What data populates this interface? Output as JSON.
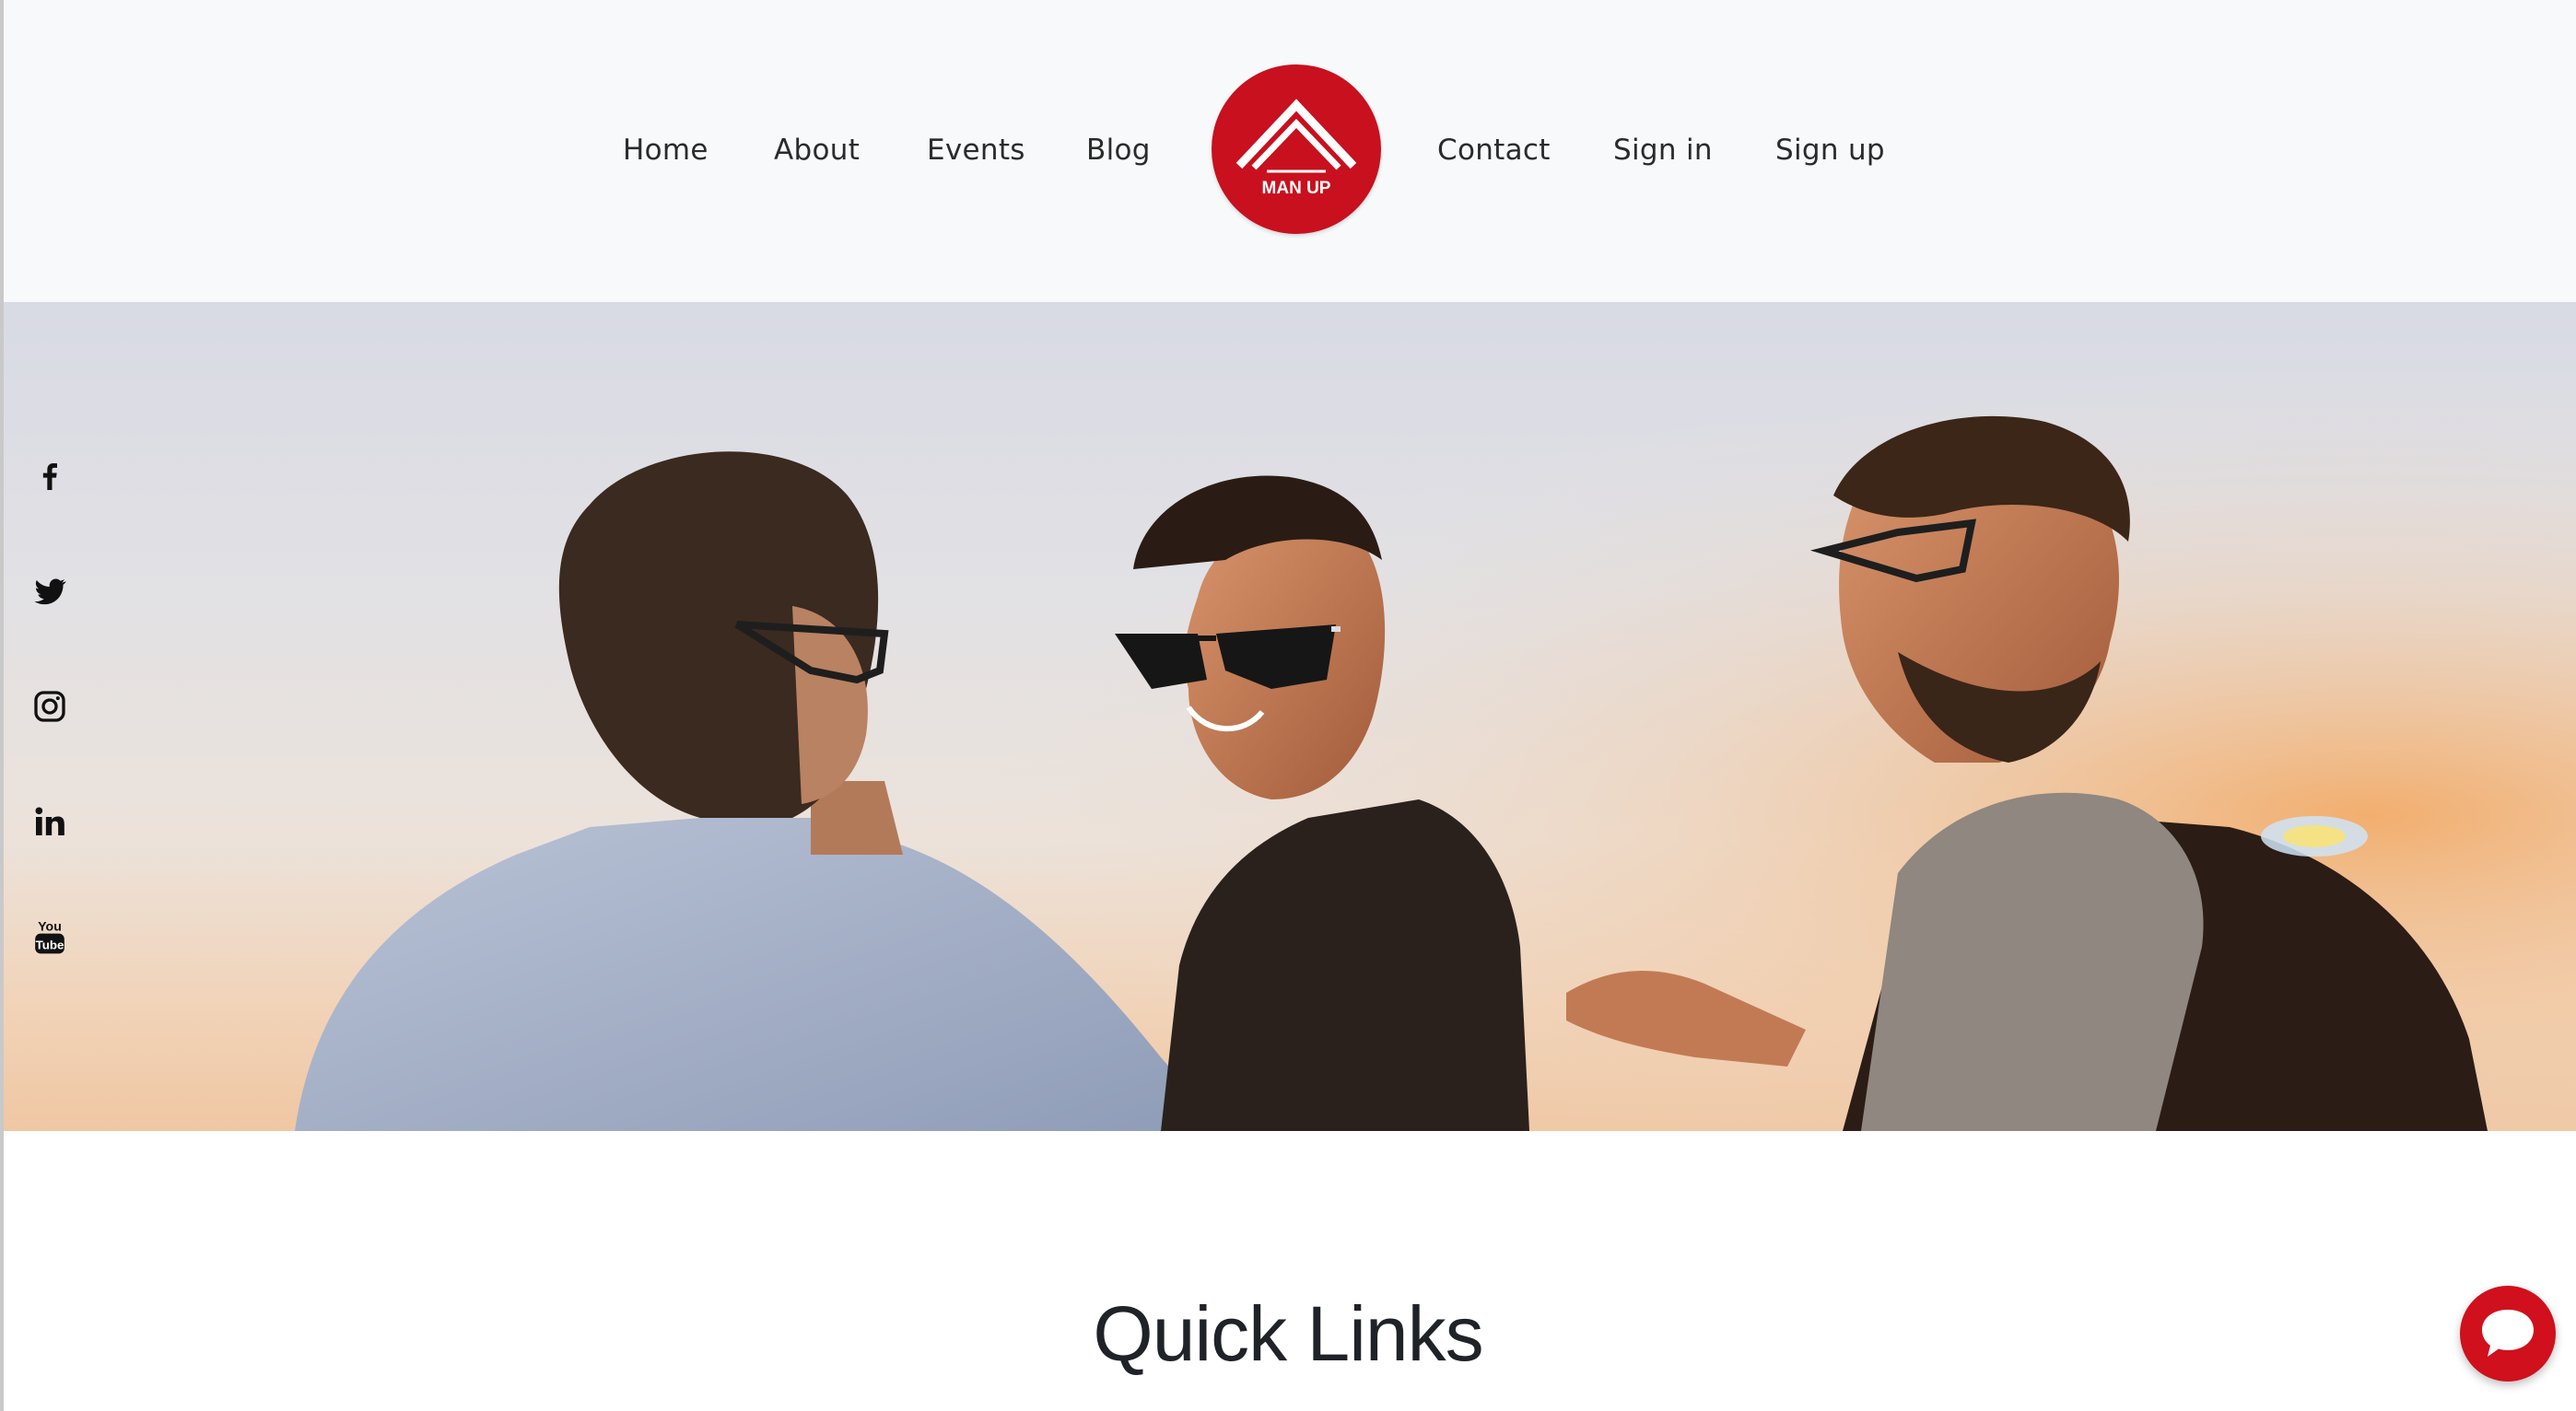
{
  "nav": {
    "left": [
      "Home",
      "About",
      "Events",
      "Blog"
    ],
    "right": [
      "Contact",
      "Sign in",
      "Sign up"
    ]
  },
  "logo": {
    "text": "MAN UP",
    "color": "#c8101e"
  },
  "hero": {
    "image": "photo-three-men-laughing-outdoors-at-sunset"
  },
  "social": [
    {
      "name": "facebook-icon"
    },
    {
      "name": "twitter-icon"
    },
    {
      "name": "instagram-icon"
    },
    {
      "name": "linkedin-icon"
    },
    {
      "name": "youtube-icon"
    }
  ],
  "quick_links": {
    "title": "Quick Links"
  },
  "chat": {
    "icon": "chat-bubble-icon",
    "color": "#d0101c"
  }
}
